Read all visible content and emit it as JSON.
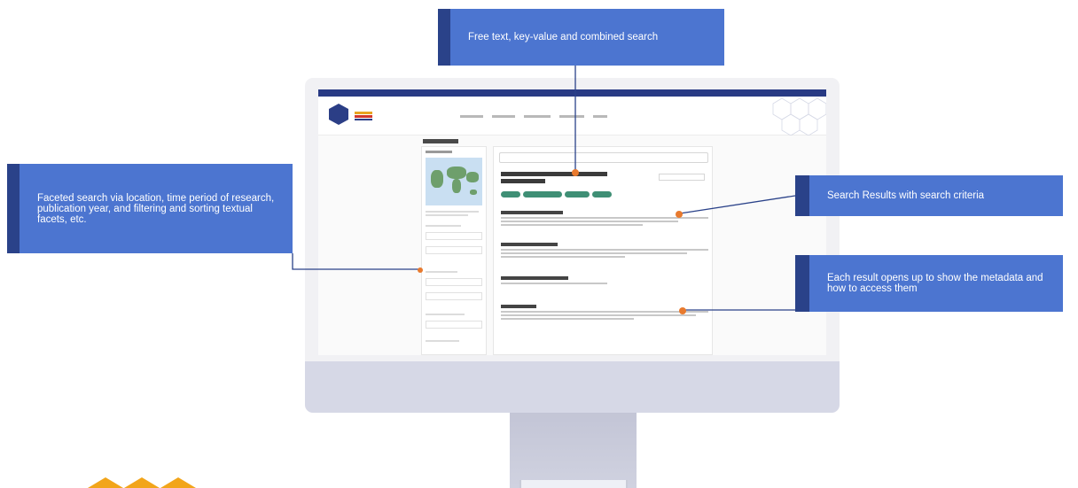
{
  "callouts": {
    "search": "Free text, key-value and combined search",
    "facets": "Faceted search via location, time period of research, publication year, and filtering and sorting textual facets, etc.",
    "results": "Search Results with search criteria",
    "metadata": "Each result opens up to show the metadata and how to access them"
  },
  "colors": {
    "callout_bg": "#4c75d0",
    "callout_bar": "#2a4289",
    "connector_dot": "#e87a2e",
    "monitor_chin": "#d6d8e6",
    "brand_orange": "#f2a51a"
  }
}
